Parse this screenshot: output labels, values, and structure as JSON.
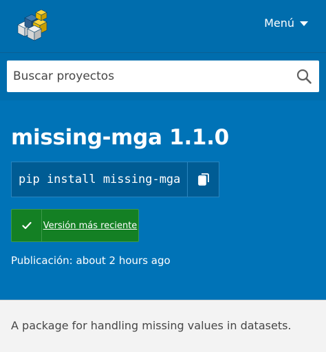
{
  "header": {
    "logo_icon": "pypi-cubes-logo-icon",
    "menu_label": "Menú"
  },
  "search": {
    "placeholder": "Buscar proyectos",
    "value": ""
  },
  "package": {
    "title": "missing-mga 1.1.0",
    "pip_command": "pip install missing-mga",
    "latest_version_label": "Versión más reciente",
    "published_text": "Publicación: about 2 hours ago",
    "description": "A package for handling missing values in datasets."
  },
  "colors": {
    "brand_blue": "#0073b7",
    "header_blue": "#006dad",
    "success_green": "#148024",
    "description_bg": "#f3f3f3"
  }
}
